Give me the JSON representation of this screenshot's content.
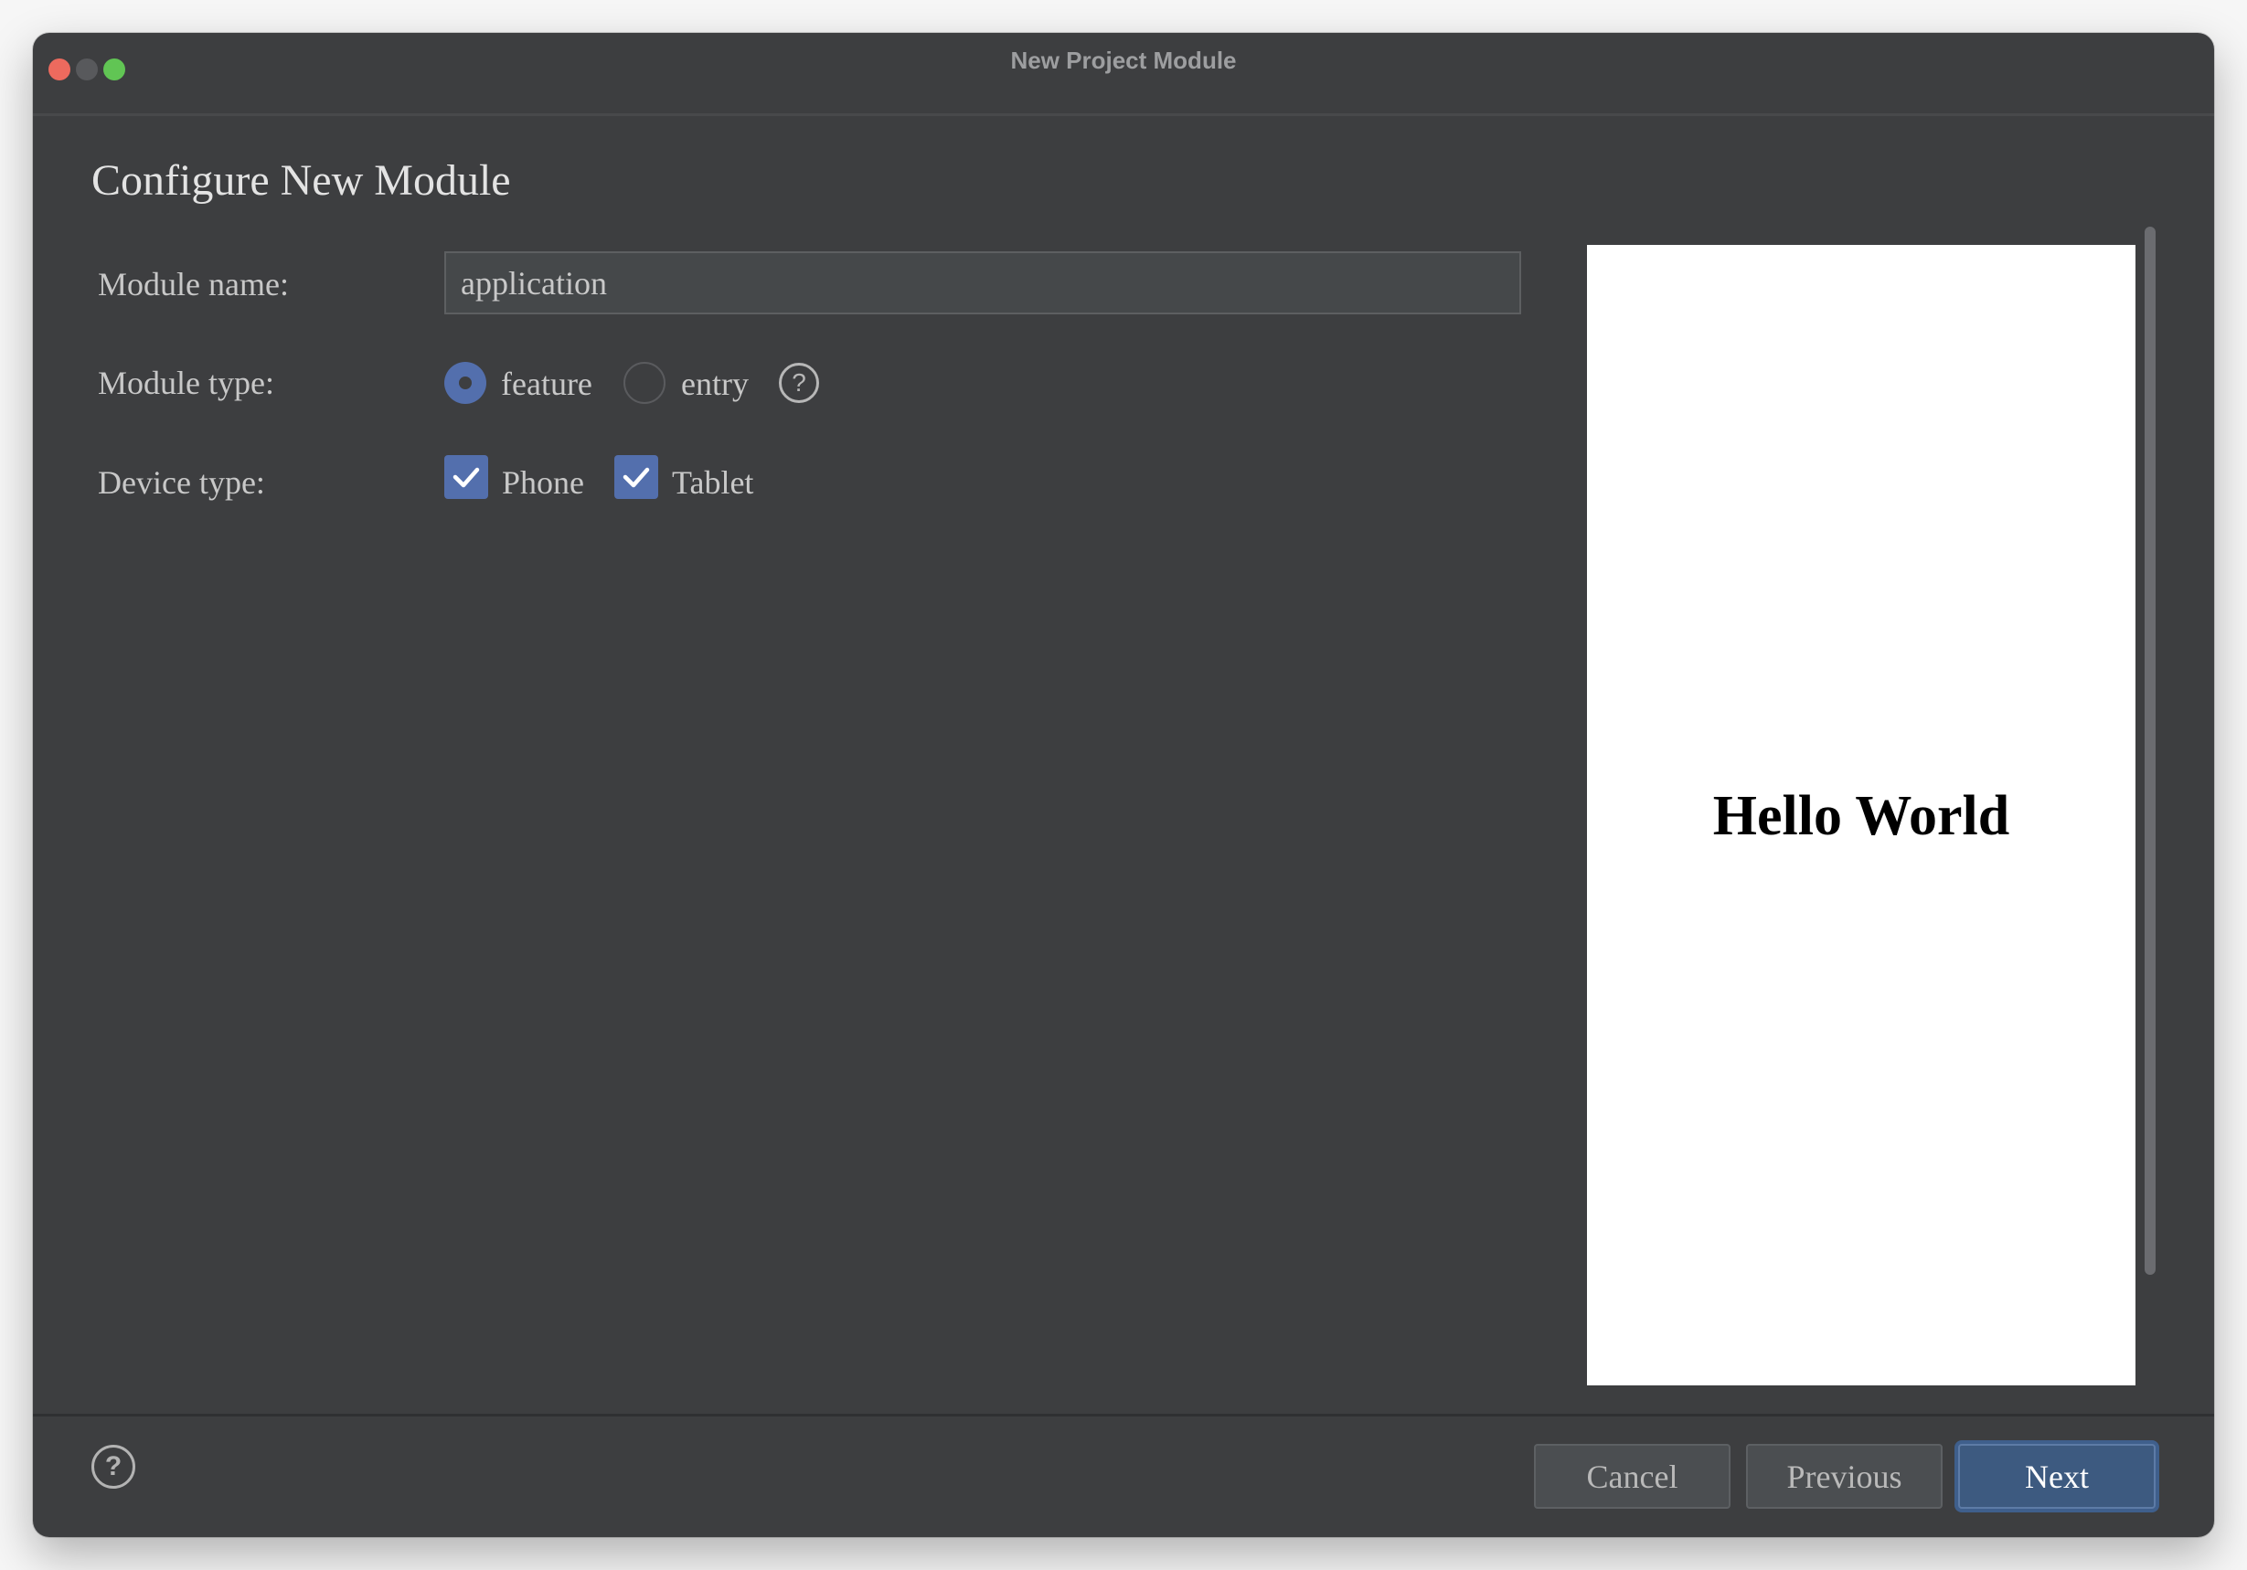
{
  "window": {
    "title": "New Project Module",
    "controls": [
      "close",
      "minimize",
      "maximize"
    ]
  },
  "page": {
    "heading": "Configure New Module"
  },
  "form": {
    "module_name": {
      "label": "Module name:",
      "value": "application"
    },
    "module_type": {
      "label": "Module type:",
      "options": [
        {
          "label": "feature",
          "selected": true
        },
        {
          "label": "entry",
          "selected": false
        }
      ],
      "help_icon": "?"
    },
    "device_type": {
      "label": "Device type:",
      "options": [
        {
          "label": "Phone",
          "checked": true
        },
        {
          "label": "Tablet",
          "checked": true
        }
      ]
    }
  },
  "preview": {
    "text": "Hello World"
  },
  "footer": {
    "help_icon": "?",
    "buttons": {
      "cancel": "Cancel",
      "previous": "Previous",
      "next": "Next"
    }
  },
  "colors": {
    "accent": "#536fad",
    "primary_button": "#3d5a80",
    "window_bg": "#3d3e40"
  }
}
